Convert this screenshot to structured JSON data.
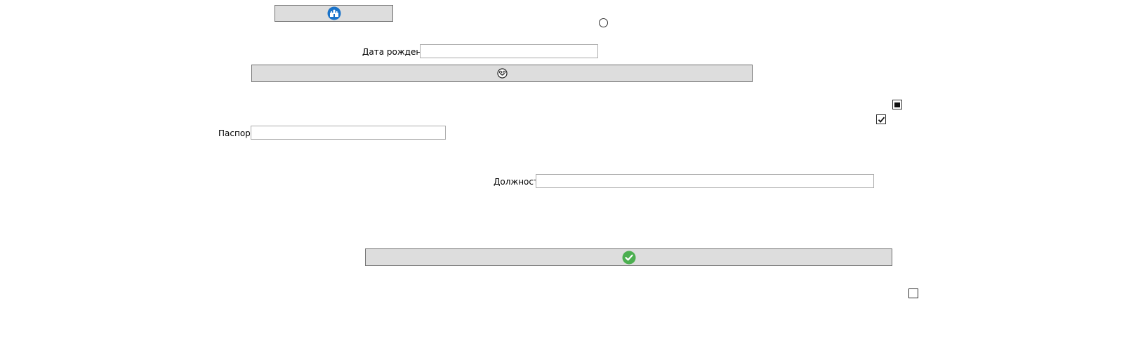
{
  "buttons": {
    "top_button_icon": "castle-badge-icon",
    "middle_button_icon": "smiley-face-icon",
    "bottom_button_icon": "check-circle-icon"
  },
  "fields": {
    "birth_date_label": "Дата рождения",
    "birth_date_value": "",
    "passport_label": "Паспорт",
    "passport_value": "",
    "position_label": "Должность",
    "position_value": ""
  },
  "controls": {
    "radio_checked": false,
    "checkbox_indeterminate": "indeterminate",
    "checkbox_checked": true,
    "checkbox_unchecked": false
  },
  "colors": {
    "button_background": "#dddddd",
    "top_icon_blue": "#1a73c9",
    "bottom_icon_green": "#4caf50"
  }
}
